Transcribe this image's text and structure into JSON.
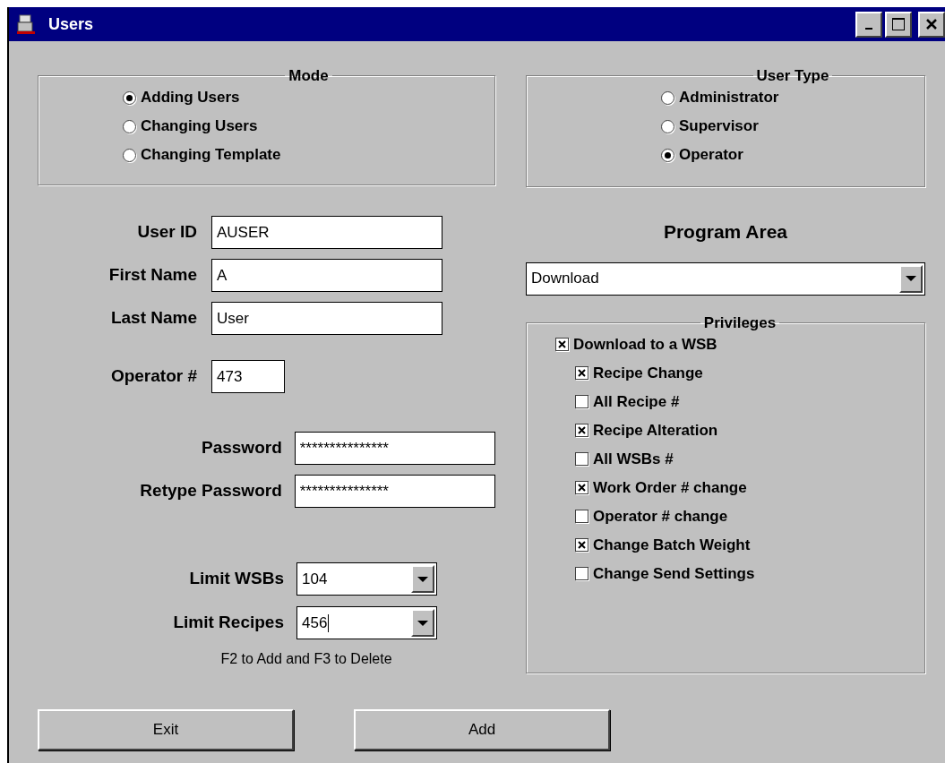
{
  "window": {
    "title": "Users"
  },
  "mode": {
    "legend": "Mode",
    "options": [
      {
        "label": "Adding Users",
        "selected": true
      },
      {
        "label": "Changing Users",
        "selected": false
      },
      {
        "label": "Changing Template",
        "selected": false
      }
    ]
  },
  "user_type": {
    "legend": "User Type",
    "options": [
      {
        "label": "Administrator",
        "selected": false
      },
      {
        "label": "Supervisor",
        "selected": false
      },
      {
        "label": "Operator",
        "selected": true
      }
    ]
  },
  "name_fields": [
    {
      "label": "User ID",
      "value": "AUSER"
    },
    {
      "label": "First Name",
      "value": "A"
    },
    {
      "label": "Last Name",
      "value": "User"
    }
  ],
  "operator_field": {
    "label": "Operator #",
    "value": "473"
  },
  "password_fields": [
    {
      "label": "Password",
      "value": "***************"
    },
    {
      "label": "Retype Password",
      "value": "***************"
    }
  ],
  "limit_fields": [
    {
      "label": "Limit WSBs",
      "value": "104",
      "focused": false
    },
    {
      "label": "Limit Recipes",
      "value": "456",
      "focused": true
    }
  ],
  "hint": "F2 to Add and F3 to Delete",
  "program_area": {
    "title": "Program Area",
    "value": "Download"
  },
  "privileges": {
    "legend": "Privileges",
    "items": [
      {
        "label": "Download to a WSB",
        "checked": true,
        "children": [
          {
            "label": "Recipe Change",
            "checked": true
          },
          {
            "label": "All Recipe #",
            "checked": false
          },
          {
            "label": "Recipe Alteration",
            "checked": true
          },
          {
            "label": "All WSBs #",
            "checked": false
          },
          {
            "label": "Work Order # change",
            "checked": true
          },
          {
            "label": "Operator # change",
            "checked": false
          },
          {
            "label": "Change Batch Weight",
            "checked": true
          },
          {
            "label": "Change Send Settings",
            "checked": false
          }
        ]
      }
    ]
  },
  "buttons": [
    "Exit",
    "Add"
  ]
}
